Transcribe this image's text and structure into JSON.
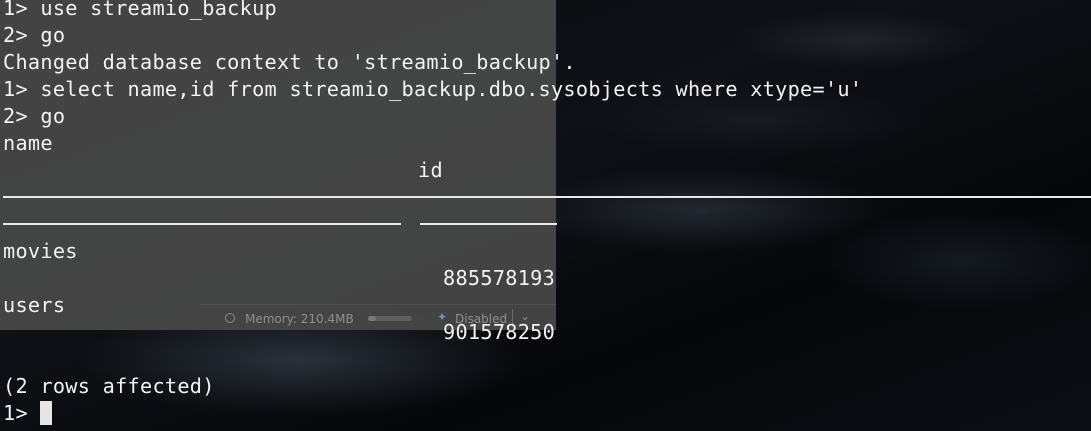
{
  "background_window": {
    "status_bar": {
      "memory": "Memory: 210.4MB",
      "ai_status": "Disabled"
    }
  },
  "terminal": {
    "lines": [
      "1> use streamio_backup",
      "2> go",
      "Changed database context to 'streamio_backup'.",
      "1> select name,id from streamio_backup.dbo.sysobjects where xtype='u'",
      "2> go"
    ],
    "result": {
      "columns": [
        "name",
        "id"
      ],
      "rows": [
        {
          "name": "movies",
          "id": "885578193"
        },
        {
          "name": "users",
          "id": "901578250"
        }
      ],
      "footer": "(2 rows affected)"
    },
    "prompt": "1> "
  }
}
